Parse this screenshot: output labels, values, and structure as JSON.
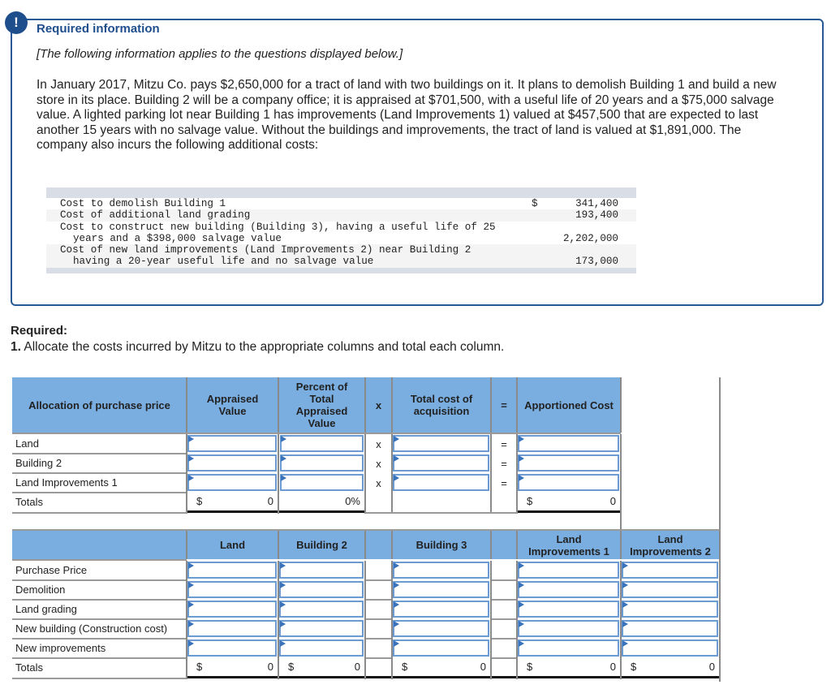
{
  "alert_icon": "!",
  "info": {
    "title": "Required information",
    "note": "[The following information applies to the questions displayed below.]",
    "paragraph": "In January 2017, Mitzu Co. pays $2,650,000 for a tract of land with two buildings on it. It plans to demolish Building 1 and build a new store in its place. Building 2 will be a company office; it is appraised at $701,500, with a useful life of 20 years and a $75,000 salvage value. A lighted parking lot near Building 1 has improvements (Land Improvements 1) valued at $457,500 that are expected to last another 15 years with no salvage value. Without the buildings and improvements, the tract of land is valued at $1,891,000. The company also incurs the following additional costs:",
    "costs": [
      {
        "line1": "Cost to demolish Building 1",
        "line2": "",
        "symbol": "$",
        "amount": "341,400"
      },
      {
        "line1": "Cost of additional land grading",
        "line2": "",
        "symbol": "",
        "amount": "193,400"
      },
      {
        "line1": "Cost to construct new building (Building 3), having a useful life of 25",
        "line2": "years and a $398,000 salvage value",
        "symbol": "",
        "amount": "2,202,000"
      },
      {
        "line1": "Cost of new land improvements (Land Improvements 2) near Building 2",
        "line2": "having a 20-year useful life and no salvage value",
        "symbol": "",
        "amount": "173,000"
      }
    ]
  },
  "required": {
    "label": "Required:",
    "number": "1.",
    "text": " Allocate the costs incurred by Mitzu to the appropriate columns and total each column."
  },
  "table1": {
    "headers": {
      "label": "Allocation of purchase price",
      "appraised": "Appraised Value",
      "percent": "Percent of Total Appraised Value",
      "times": "x",
      "total_cost": "Total cost of acquisition",
      "equals": "=",
      "apportioned": "Apportioned Cost"
    },
    "rows": [
      {
        "label": "Land",
        "times": "x",
        "equals": "=",
        "appraised": "",
        "percent": "",
        "total_cost": "",
        "apportioned": ""
      },
      {
        "label": "Building 2",
        "times": "x",
        "equals": "=",
        "appraised": "",
        "percent": "",
        "total_cost": "",
        "apportioned": ""
      },
      {
        "label": "Land Improvements 1",
        "times": "x",
        "equals": "=",
        "appraised": "",
        "percent": "",
        "total_cost": "",
        "apportioned": ""
      }
    ],
    "totals": {
      "label": "Totals",
      "appraised_symbol": "$",
      "appraised": "0",
      "percent": "0%",
      "apportioned_symbol": "$",
      "apportioned": "0"
    }
  },
  "table2": {
    "headers": [
      "Land",
      "Building 2",
      "Building 3",
      "Land Improvements 1",
      "Land Improvements 2"
    ],
    "rows": [
      {
        "label": "Purchase Price"
      },
      {
        "label": "Demolition"
      },
      {
        "label": "Land grading"
      },
      {
        "label": "New building (Construction cost)"
      },
      {
        "label": "New improvements"
      }
    ],
    "totals": {
      "label": "Totals",
      "symbol": "$",
      "values": [
        "0",
        "0",
        "0",
        "0",
        "0"
      ]
    }
  }
}
